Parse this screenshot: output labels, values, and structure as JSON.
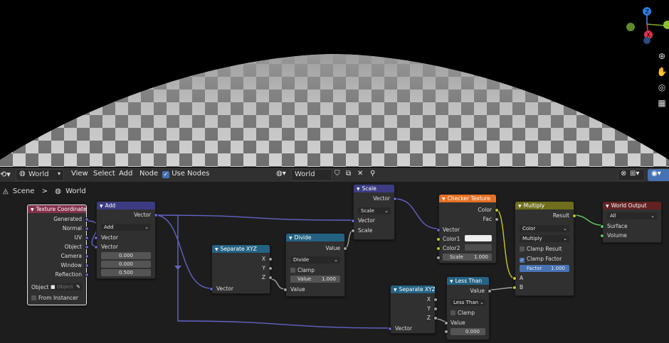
{
  "viewport": {
    "gizmo": {
      "z_label": "Z",
      "x_label": "X"
    },
    "tools": [
      {
        "icon": "zoom-icon",
        "glyph": "⊕"
      },
      {
        "icon": "hand-pan-icon",
        "glyph": "✋"
      },
      {
        "icon": "camera-icon",
        "glyph": "◎"
      },
      {
        "icon": "grid-icon",
        "glyph": "▦"
      }
    ]
  },
  "header": {
    "editor_type_icon": "node-editor-icon",
    "shader_type": "World",
    "menus": [
      "View",
      "Select",
      "Add",
      "Node"
    ],
    "use_nodes_label": "Use Nodes",
    "use_nodes_checked": true,
    "world_name": "World"
  },
  "breadcrumb": {
    "scene": "Scene",
    "separator": ">",
    "world": "World"
  },
  "colors": {
    "vector_socket": "#6363c7",
    "float_socket": "#a1a1a1",
    "color_socket": "#c7c729",
    "shader_socket": "#63c763",
    "input_header": "#83314a",
    "vector_header": "#3c3c83",
    "converter_header": "#246283",
    "texture_header": "#e66f22",
    "color_header": "#6e6e1d",
    "output_header": "#632123"
  },
  "nodes": {
    "texcoord": {
      "title": "Texture Coordinate",
      "outputs": [
        "Generated",
        "Normal",
        "UV",
        "Object",
        "Camera",
        "Window",
        "Reflection"
      ],
      "object_label": "Object:",
      "object_placeholder": "Object",
      "from_instancer": "From Instancer"
    },
    "add": {
      "title": "Add",
      "output": "Vector",
      "operation": "Add",
      "inputs": [
        "Vector",
        "Vector"
      ],
      "values": [
        "0.000",
        "0.000",
        "0.500"
      ]
    },
    "sepxyz1": {
      "title": "Separate XYZ",
      "outputs": [
        "X",
        "Y",
        "Z"
      ],
      "input": "Vector"
    },
    "divide": {
      "title": "Divide",
      "output": "Value",
      "operation": "Divide",
      "clamp": "Clamp",
      "input": "Value",
      "value_label": "Value",
      "value": "1.000"
    },
    "scale": {
      "title": "Scale",
      "output": "Vector",
      "operation": "Scale",
      "inputs": [
        "Vector",
        "Scale"
      ]
    },
    "checker": {
      "title": "Checker Texture",
      "outputs": [
        "Color",
        "Fac"
      ],
      "inputs": [
        "Vector",
        "Color1",
        "Color2"
      ],
      "color1": "#eeeeee",
      "color2": "#4d4d4d",
      "scale_label": "Scale",
      "scale_value": "1.000"
    },
    "sepxyz2": {
      "title": "Separate XYZ",
      "outputs": [
        "X",
        "Y",
        "Z"
      ],
      "input": "Vector"
    },
    "lessthan": {
      "title": "Less Than",
      "output": "Value",
      "operation": "Less Than",
      "clamp": "Clamp",
      "input": "Value",
      "value": "0.000"
    },
    "multiply": {
      "title": "Multiply",
      "output": "Result",
      "data_type": "Color",
      "blend": "Multiply",
      "clamp_result": "Clamp Result",
      "clamp_factor": "Clamp Factor",
      "factor_label": "Factor",
      "factor_value": "1.000",
      "inputs": [
        "A",
        "B"
      ]
    },
    "output": {
      "title": "World Output",
      "target": "All",
      "inputs": [
        "Surface",
        "Volume"
      ]
    }
  }
}
